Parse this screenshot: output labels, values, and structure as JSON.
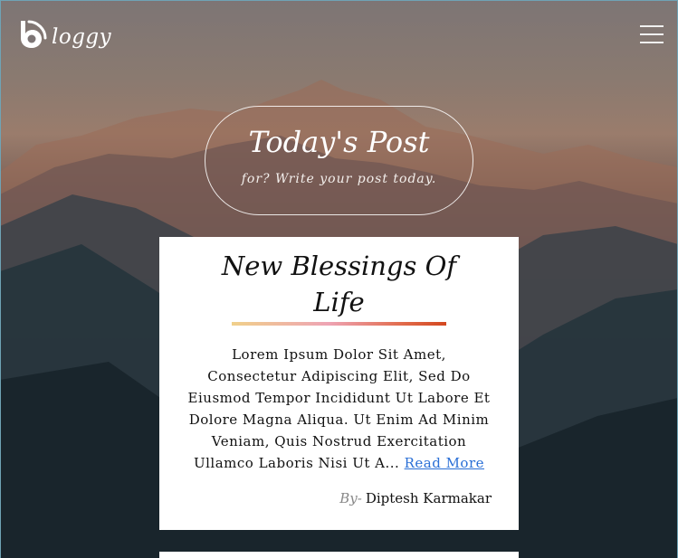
{
  "header": {
    "logo_text": "loggy",
    "logo_icon": "b-signal-icon",
    "menu_icon": "hamburger-icon"
  },
  "hero": {
    "title": "Today's Post",
    "subtitle": "for? Write your post today."
  },
  "posts": [
    {
      "title": "New Blessings Of Life",
      "excerpt": "Lorem Ipsum Dolor Sit Amet, Consectetur Adipiscing Elit, Sed Do Eiusmod Tempor Incididunt Ut Labore Et Dolore Magna Aliqua. Ut Enim Ad Minim Veniam, Quis Nostrud Exercitation Ullamco Laboris Nisi Ut A...",
      "read_more": "Read More",
      "by_label": "By-",
      "author": "Diptesh Karmakar"
    }
  ],
  "colors": {
    "accent_link": "#2a6fd6",
    "rule_start": "#f0d08a",
    "rule_mid": "#eea4b4",
    "rule_end": "#d3471f"
  }
}
